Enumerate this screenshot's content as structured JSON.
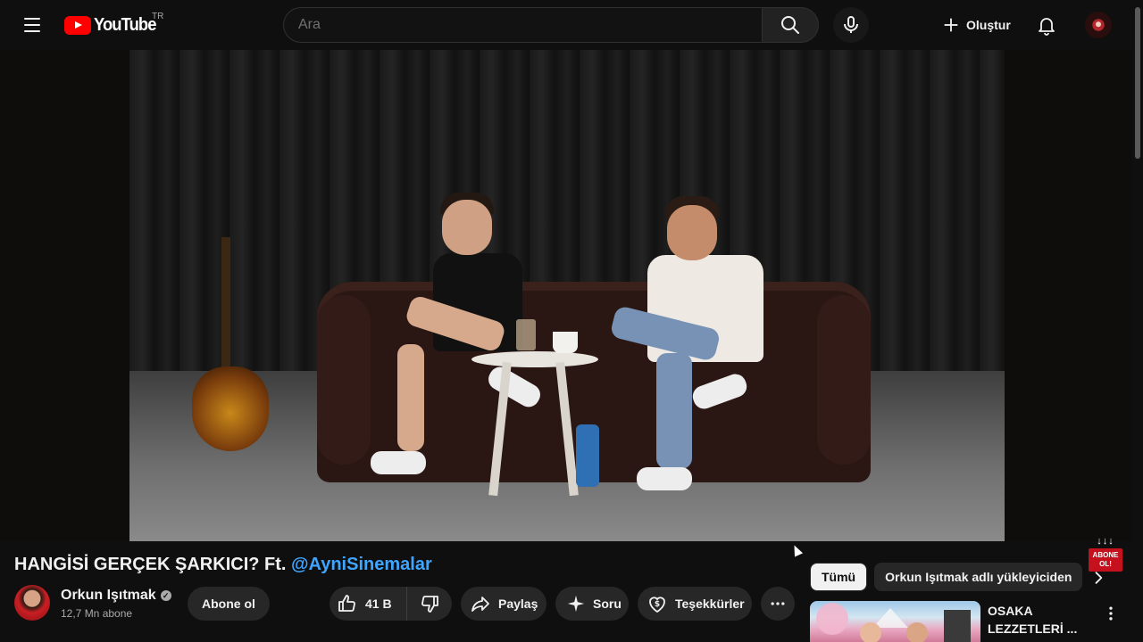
{
  "header": {
    "logo_text": "YouTube",
    "country_code": "TR",
    "search_placeholder": "Ara",
    "create_label": "Oluştur"
  },
  "video": {
    "title_main": "HANGİSİ GERÇEK ŞARKICI? Ft. ",
    "title_mention": "@AyniSinemalar",
    "promo_arrows": "↓↓↓",
    "promo_badge": "ABONE OL!"
  },
  "channel": {
    "name": "Orkun Işıtmak",
    "verified_mark": "✓",
    "subscribers": "12,7 Mn abone",
    "subscribe_label": "Abone ol"
  },
  "actions": {
    "like_count": "41 B",
    "share_label": "Paylaş",
    "ask_label": "Soru",
    "thanks_label": "Teşekkürler"
  },
  "sidebar": {
    "chips": [
      "Tümü",
      "Orkun Işıtmak adlı yükleyiciden"
    ],
    "recommendations": [
      {
        "title": "OSAKA LEZZETLERİ ..."
      }
    ]
  },
  "colors": {
    "background": "#0f0f0f",
    "accent_red": "#ff0000",
    "link_blue": "#3ea6ff",
    "pill_bg": "#272727"
  },
  "icons": [
    "menu-icon",
    "youtube-logo-icon",
    "search-icon",
    "mic-icon",
    "plus-icon",
    "bell-icon",
    "user-avatar-icon",
    "verified-icon",
    "thumbs-up-icon",
    "thumbs-down-icon",
    "share-icon",
    "sparkle-icon",
    "thanks-icon",
    "more-icon",
    "chevron-right-icon",
    "more-vert-icon"
  ]
}
